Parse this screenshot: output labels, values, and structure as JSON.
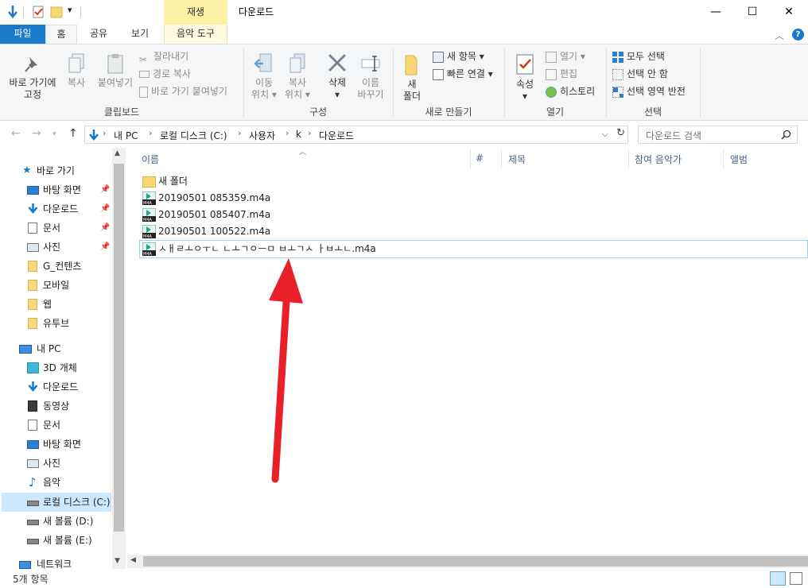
{
  "titlebar": {
    "context_tab": "재생",
    "title": "다운로드",
    "minimize": "—",
    "maximize": "☐",
    "close": "✕"
  },
  "ribbon_tabs": [
    "파일",
    "홈",
    "공유",
    "보기",
    "음악 도구"
  ],
  "ribbon": {
    "clipboard": {
      "pin_quick": "바로 가기에\n고정",
      "copy": "복사",
      "paste": "붙여넣기",
      "cut": "잘라내기",
      "copy_path": "경로 복사",
      "paste_shortcut": "바로 가기 붙여넣기",
      "label": "클립보드"
    },
    "organize": {
      "move_to": "이동\n위치 ▾",
      "copy_to": "복사\n위치 ▾",
      "delete": "삭제\n▾",
      "rename": "이름\n바꾸기",
      "label": "구성"
    },
    "new": {
      "new_folder": "새\n폴더",
      "new_item": "새 항목 ▾",
      "easy_access": "빠른 연결 ▾",
      "label": "새로 만들기"
    },
    "open": {
      "properties": "속성\n▾",
      "open": "열기 ▾",
      "edit": "편집",
      "history": "히스토리",
      "label": "열기"
    },
    "select": {
      "select_all": "모두 선택",
      "select_none": "선택 안 함",
      "invert": "선택 영역 반전",
      "label": "선택"
    }
  },
  "address": {
    "crumbs": [
      "내 PC",
      "로컬 디스크 (C:)",
      "사용자",
      "k",
      "다운로드"
    ],
    "search_placeholder": "다운로드 검색"
  },
  "nav": {
    "quick_access": "바로 가기",
    "items": [
      {
        "label": "바탕 화면",
        "pinned": true
      },
      {
        "label": "다운로드",
        "pinned": true
      },
      {
        "label": "문서",
        "pinned": true
      },
      {
        "label": "사진",
        "pinned": true
      },
      {
        "label": "G_컨텐츠",
        "pinned": false
      },
      {
        "label": "모바일",
        "pinned": false
      },
      {
        "label": "웹",
        "pinned": false
      },
      {
        "label": "유투브",
        "pinned": false
      }
    ],
    "this_pc": "내 PC",
    "pc_items": [
      "3D 개체",
      "다운로드",
      "동영상",
      "문서",
      "바탕 화면",
      "사진",
      "음악",
      "로컬 디스크 (C:)",
      "새 볼륨 (D:)",
      "새 볼륨 (E:)"
    ],
    "network": "네트워크"
  },
  "columns": [
    "이름",
    "#",
    "제목",
    "참여 음악가",
    "앨범"
  ],
  "files": [
    {
      "name": "새 폴더",
      "type": "folder"
    },
    {
      "name": "20190501 085359.m4a",
      "type": "m4a"
    },
    {
      "name": "20190501 085407.m4a",
      "type": "m4a"
    },
    {
      "name": "20190501 100522.m4a",
      "type": "m4a"
    },
    {
      "name": "ㅅㅐㄹㅗㅇㅜㄴ ㄴㅗㄱㅇㅡㅁ ㅂㅗㄱㅅ ㅏㅂㅗㄴ.m4a",
      "type": "m4a",
      "editing": true
    }
  ],
  "status": {
    "count": "5개 항목"
  },
  "colors": {
    "accent": "#1979ca",
    "context_tab": "#fdf1a6",
    "selection": "#cce8ff",
    "arrow": "#e8202a"
  }
}
